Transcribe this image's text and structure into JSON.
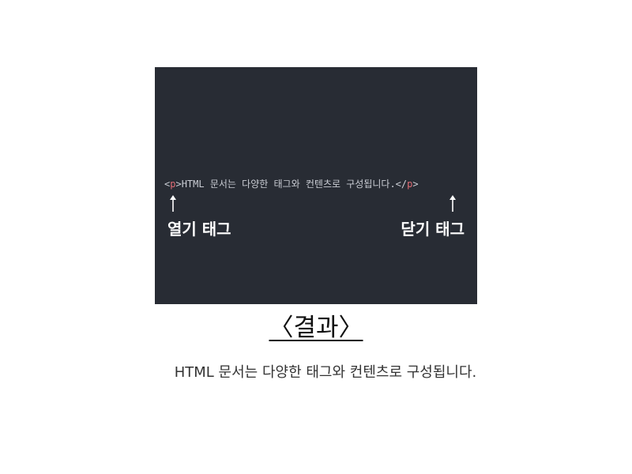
{
  "code_example": {
    "open_bracket": "<",
    "open_tag_name": "p",
    "open_close_bracket": ">",
    "content": "HTML 문서는 다양한 태그와 컨텐츠로 구성됩니다.",
    "close_open_bracket": "</",
    "close_tag_name": "p",
    "close_close_bracket": ">"
  },
  "annotations": {
    "open_tag_label": "열기 태그",
    "close_tag_label": "닫기 태그"
  },
  "caption": "〈결과〉",
  "result_text": "HTML 문서는 다양한 태그와 컨텐츠로 구성됩니다.",
  "colors": {
    "panel_background": "#282c34",
    "tag_name": "#e06c75",
    "code_text": "#c9ccd3"
  },
  "icons": {
    "annotation_arrow": "arrow-up-icon"
  }
}
